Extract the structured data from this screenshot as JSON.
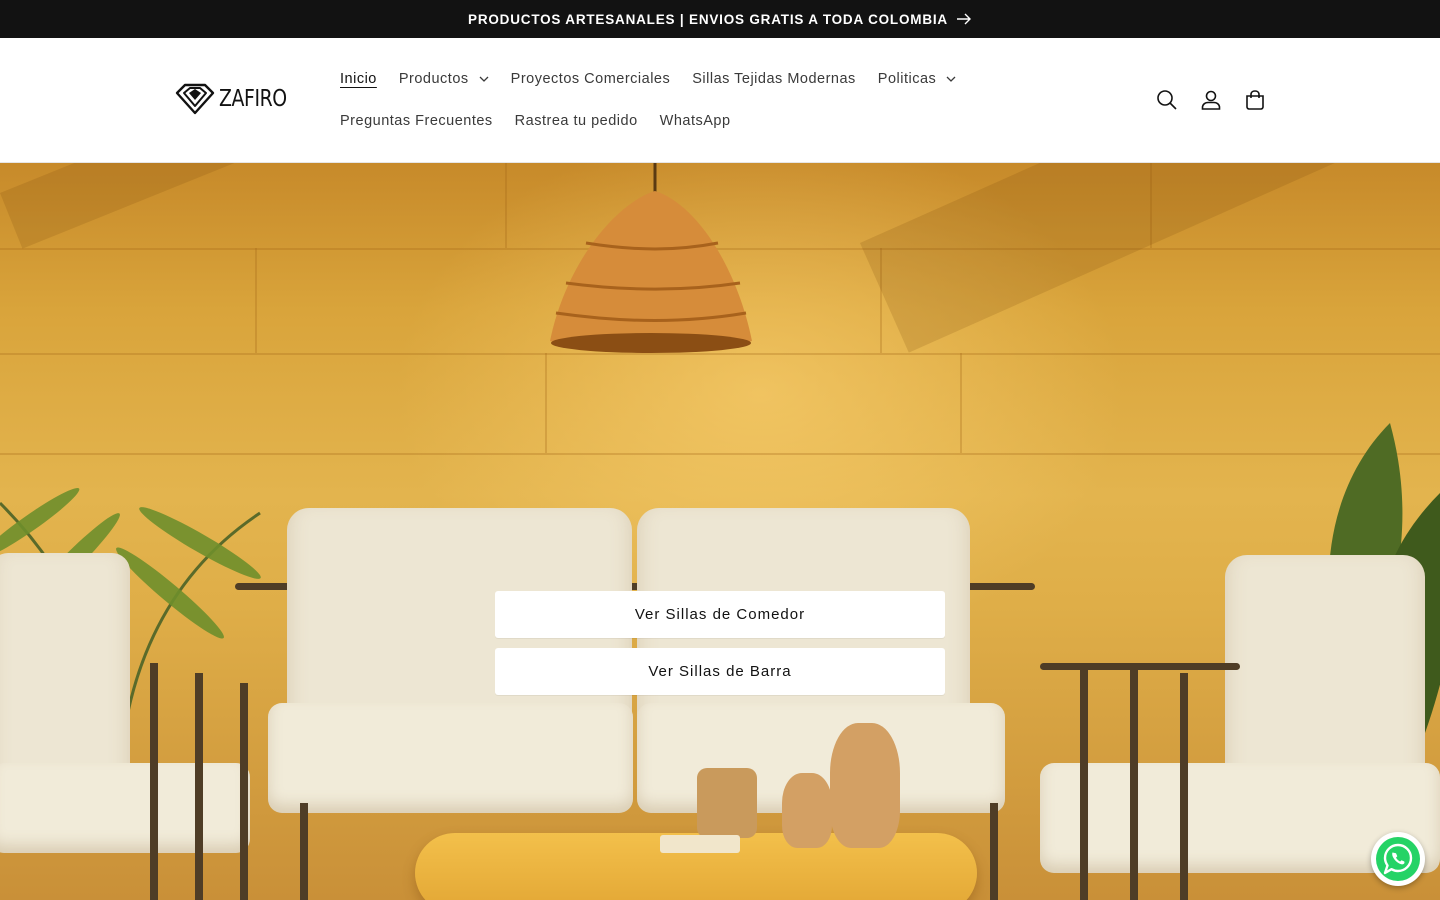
{
  "announcement": {
    "text": "PRODUCTOS ARTESANALES | ENVIOS GRATIS A TODA COLOMBIA",
    "icon": "arrow-right-icon"
  },
  "header": {
    "logo_text": "ZAFIRO",
    "nav_row1": [
      {
        "label": "Inicio",
        "active": true,
        "dropdown": false
      },
      {
        "label": "Productos",
        "active": false,
        "dropdown": true
      },
      {
        "label": "Proyectos Comerciales",
        "active": false,
        "dropdown": false
      },
      {
        "label": "Sillas Tejidas Modernas",
        "active": false,
        "dropdown": false
      },
      {
        "label": "Politicas",
        "active": false,
        "dropdown": true
      }
    ],
    "nav_row2": [
      {
        "label": "Preguntas Frecuentes"
      },
      {
        "label": "Rastrea tu pedido"
      },
      {
        "label": "WhatsApp"
      }
    ],
    "icons": [
      "search-icon",
      "account-icon",
      "cart-icon"
    ]
  },
  "hero": {
    "buttons": [
      {
        "label": "Ver Sillas de Comedor"
      },
      {
        "label": "Ver Sillas de Barra"
      }
    ]
  },
  "floating": {
    "icon": "whatsapp-icon"
  },
  "colors": {
    "announcement_bg": "#121212",
    "hero_wall": "#e3b44e",
    "whatsapp_green": "#25d366"
  }
}
